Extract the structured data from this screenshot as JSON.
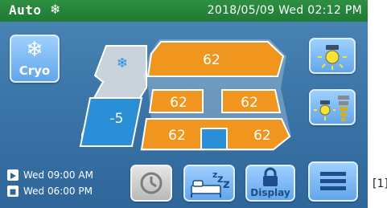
{
  "header": {
    "mode": "Auto",
    "mode_icon": "snowflake-icon",
    "datetime": "2018/05/09 Wed   02:12 PM"
  },
  "cryo_button": {
    "label": "Cryo",
    "icon": "snowflake-icon"
  },
  "bed": {
    "left": {
      "temperature": "-5",
      "icon": "snowflake-icon",
      "color": "#2a8fd6"
    },
    "right": {
      "color": "#f0961e",
      "head": "62",
      "middle_left": "62",
      "middle_right": "62",
      "foot_left": "62",
      "foot_right": "62"
    }
  },
  "side_buttons": {
    "light_icon": "light-bulb-icon",
    "brightness_icon": "brightness-icon"
  },
  "timers": [
    {
      "icon": "play-icon",
      "text": "Wed 09:00 AM"
    },
    {
      "icon": "stop-icon",
      "text": "Wed 06:00 PM"
    }
  ],
  "bottom_buttons": {
    "schedule_icon": "clock-icon",
    "sleep_icon": "sleep-icon",
    "display_label": "Display",
    "display_icon": "lock-icon",
    "menu_icon": "menu-icon"
  },
  "footnote": "[1]"
}
